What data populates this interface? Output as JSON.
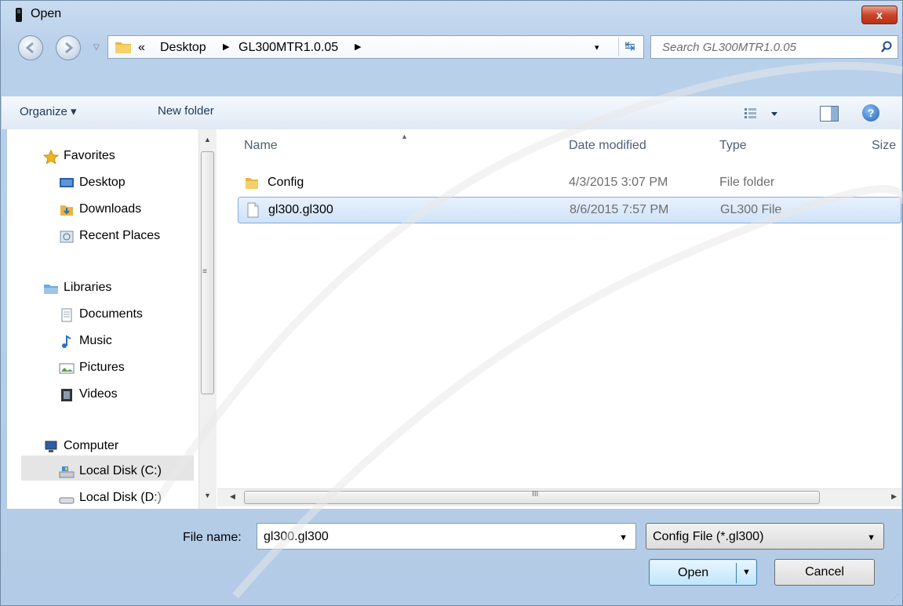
{
  "window": {
    "title": "Open",
    "close_label": "x"
  },
  "nav": {
    "dropdown": "▽"
  },
  "address": {
    "overflow": "«",
    "crumbs": [
      "Desktop",
      "GL300MTR1.0.05"
    ],
    "dropdown": "▾",
    "refresh": "↹"
  },
  "search": {
    "placeholder": "Search GL300MTR1.0.05"
  },
  "toolbar": {
    "organize": "Organize ▾",
    "new_folder": "New folder",
    "help": "?"
  },
  "sidebar": {
    "items": [
      {
        "label": "Favorites",
        "icon": "star-icon"
      },
      {
        "label": "Desktop",
        "icon": "desktop-icon"
      },
      {
        "label": "Downloads",
        "icon": "downloads-icon"
      },
      {
        "label": "Recent Places",
        "icon": "recent-places-icon"
      },
      {
        "label": "Libraries",
        "icon": "libraries-icon"
      },
      {
        "label": "Documents",
        "icon": "documents-icon"
      },
      {
        "label": "Music",
        "icon": "music-icon"
      },
      {
        "label": "Pictures",
        "icon": "pictures-icon"
      },
      {
        "label": "Videos",
        "icon": "videos-icon"
      },
      {
        "label": "Computer",
        "icon": "computer-icon"
      },
      {
        "label": "Local Disk (C:)",
        "icon": "drive-icon"
      },
      {
        "label": "Local Disk (D:)",
        "icon": "drive-icon"
      }
    ]
  },
  "files": {
    "columns": [
      "Name",
      "Date modified",
      "Type",
      "Size"
    ],
    "rows": [
      {
        "name": "Config",
        "date": "4/3/2015 3:07 PM",
        "type": "File folder",
        "icon": "folder-icon"
      },
      {
        "name": "gl300.gl300",
        "date": "8/6/2015 7:57 PM",
        "type": "GL300 File",
        "icon": "file-icon"
      }
    ],
    "scroll_grip": "III"
  },
  "form": {
    "file_name_label": "File name:",
    "file_name_value": "gl300.gl300",
    "file_type": "Config File (*.gl300)",
    "open": "Open",
    "cancel": "Cancel"
  },
  "colors": {
    "accent": "#3c7fb1",
    "selection": "#cfe3f8",
    "chrome": "#b9d0ea"
  }
}
